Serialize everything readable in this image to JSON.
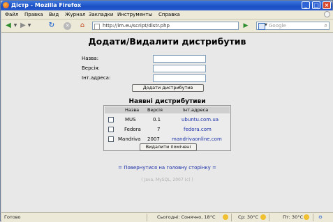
{
  "window": {
    "title": "Дістр - Mozilla Firefox"
  },
  "menu": [
    "Файл",
    "Правка",
    "Вид",
    "Журнал",
    "Закладки",
    "Инструменты",
    "Справка"
  ],
  "toolbar": {
    "url": "http://im.eu/script/distr.php",
    "search_placeholder": "Google"
  },
  "page": {
    "title": "Додати/Видалити дистрибутив",
    "form": {
      "name_label": "Назва:",
      "version_label": "Версія:",
      "address_label": "Інт.адреса:",
      "submit_label": "Додати дистрибутив"
    },
    "list_title": "Наявні дистрибутиви",
    "columns": [
      "Назва",
      "Версія",
      "Інт.адреса"
    ],
    "rows": [
      {
        "name": "MUS",
        "version": "0.1",
        "address": "ubuntu.com.ua"
      },
      {
        "name": "Fedora",
        "version": "7",
        "address": "fedora.com"
      },
      {
        "name": "Mandriva",
        "version": "2007",
        "address": "mandrivaonline.com"
      }
    ],
    "delete_label": "Видалити помічені",
    "back_link": "= Повернутися на головну сторінку =",
    "footer": "( Java, MySQL, 2007 (c) )"
  },
  "status": {
    "left": "Готово",
    "weather_today": "Сьогодні: Сонячно, 18°C",
    "weather_wed": "Ср: 30°C",
    "weather_thu": "Пт: 30°C"
  }
}
